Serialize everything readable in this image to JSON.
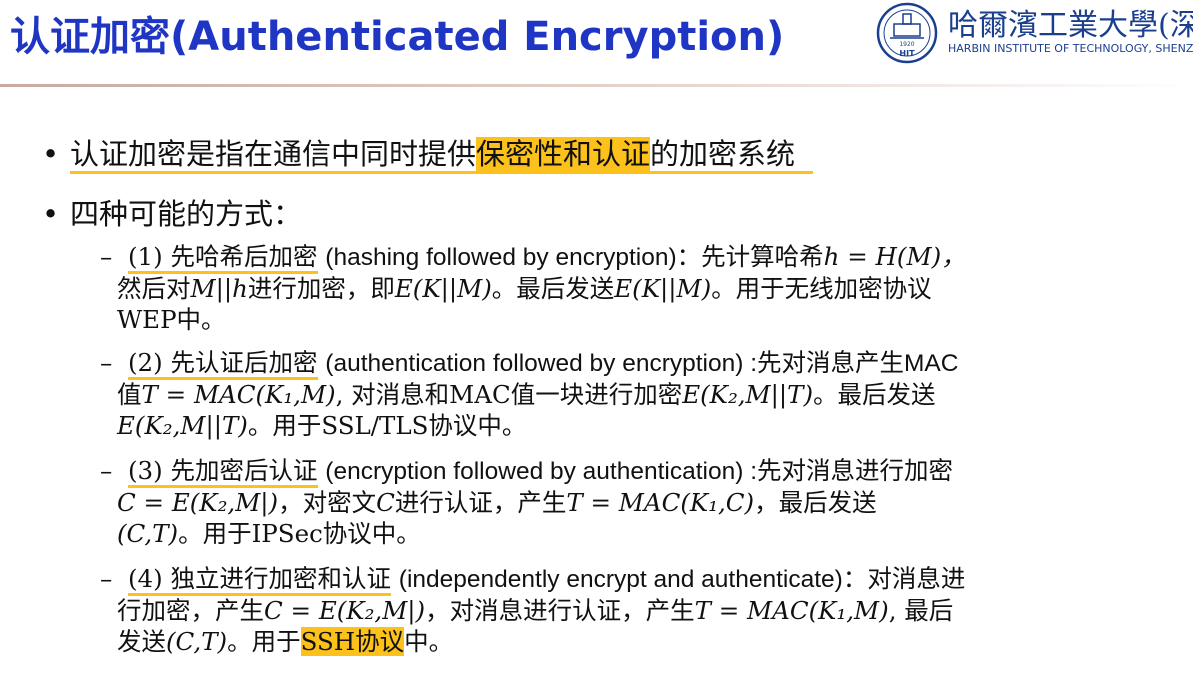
{
  "title": "认证加密(Authenticated Encryption)",
  "logo": {
    "name_cn": "哈爾濱工業大學(深圳)",
    "name_en": "HARBIN INSTITUTE OF TECHNOLOGY, SHENZHEN",
    "badge_year": "1920",
    "badge_text": "HIT"
  },
  "bullet1": {
    "pre": "认证加密是指在通信中同时提供",
    "highlight": "保密性和认证",
    "post": "的加密系统"
  },
  "bullet2": {
    "text": "四种可能的方式："
  },
  "items": [
    {
      "label": "(1) 先哈希后加密",
      "line1_en": "(hashing followed by encryption)：先计算哈希",
      "line1_math": "h = H(M)，",
      "line2_a": "然后对",
      "line2_m1": "M||h",
      "line2_b": "进行加密，即",
      "line2_m2": "E(K||M)",
      "line2_c": "。最后发送",
      "line2_m3": "E(K||M)",
      "line2_d": "。用于无线加密协议",
      "line3": "WEP中。"
    },
    {
      "label": "(2) 先认证后加密",
      "line1_en": "(authentication followed by encryption) :先对消息产生MAC",
      "line2_a": "值",
      "line2_m1": "T = MAC(K₁,M)",
      "line2_b": ", 对消息和MAC值一块进行加密",
      "line2_m2": "E(K₂,M||T)",
      "line2_c": "。最后发送",
      "line3_m": "E(K₂,M||T)",
      "line3_b": "。用于SSL/TLS协议中。"
    },
    {
      "label": "(3) 先加密后认证",
      "line1_en": "(encryption followed by authentication) :先对消息进行加密",
      "line2_m1": "C = E(K₂,M|)",
      "line2_a": "，对密文",
      "line2_m2": "C",
      "line2_b": "进行认证，产生",
      "line2_m3": "T = MAC(K₁,C)",
      "line2_c": "，最后发送",
      "line3_m": "(C,T)",
      "line3_b": "。用于IPSec协议中。"
    },
    {
      "label": "(4) 独立进行加密和认证",
      "line1_en": "(independently encrypt and authenticate)：对消息进",
      "line2_a": "行加密，产生",
      "line2_m1": "C = E(K₂,M|)",
      "line2_b": "，对消息进行认证，产生",
      "line2_m2": "T = MAC(K₁,M)",
      "line2_c": ", 最后",
      "line3_a": "发送",
      "line3_m": "(C,T)",
      "line3_b": "。用于",
      "line3_hl": "SSH协议",
      "line3_c": "中。"
    }
  ],
  "colors": {
    "title": "#1f35c4",
    "highlight": "#fcc21b",
    "logo": "#1b3f8f"
  }
}
